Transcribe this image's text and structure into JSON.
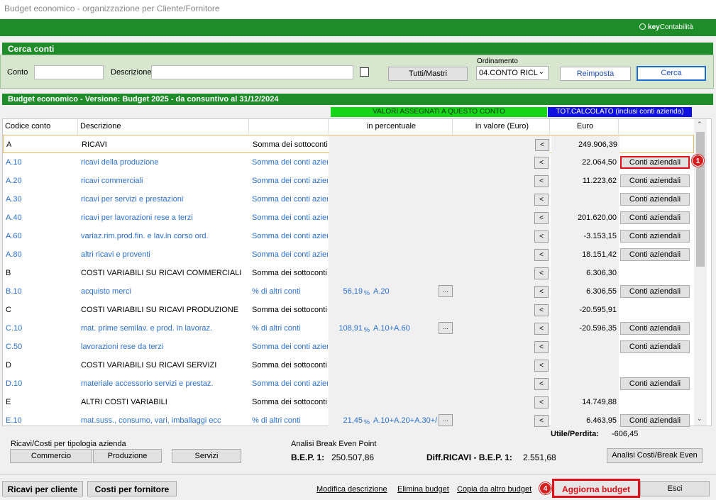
{
  "window": {
    "title": "Budget economico - organizzazione per Cliente/Fornitore"
  },
  "brand": {
    "key": "key",
    "name": "Contabilità"
  },
  "search": {
    "section_title": "Cerca conti",
    "conto_label": "Conto",
    "conto_value": "",
    "descrizione_label": "Descrizione",
    "descrizione_value": "",
    "tutti_label": "Tutti/Mastri",
    "ordinamento_label": "Ordinamento",
    "ordinamento_value": "04.CONTO RICL",
    "reimposta_label": "Reimposta",
    "cerca_label": "Cerca"
  },
  "budget": {
    "title": "Budget economico - Versione:   Budget 2025 - da consuntivo al 31/12/2024",
    "banner_assigned": "VALORI ASSEGNATI A QUESTO CONTO",
    "banner_total": "TOT.CALCOLATO (inclusi conti azienda)",
    "columns": [
      "Codice conto",
      "Descrizione",
      "",
      "in percentuale",
      "in valore (Euro)",
      "Euro"
    ],
    "row_button": "<",
    "aziendali_button": "Conti aziendali",
    "dots_button": "...",
    "pct_sign": "%",
    "rows": [
      {
        "code": "A",
        "desc": "RICAVI",
        "type": "Somma dei sottoconti",
        "pct": "",
        "ref": "",
        "euro": "249.906,39",
        "main": true,
        "dots": false,
        "btn": false
      },
      {
        "code": "A.10",
        "desc": "ricavi della produzione",
        "type": "Somma dei conti azien",
        "pct": "",
        "ref": "",
        "euro": "22.064,50",
        "main": false,
        "dots": false,
        "btn": true
      },
      {
        "code": "A.20",
        "desc": "ricavi commerciali",
        "type": "Somma dei conti azien",
        "pct": "",
        "ref": "",
        "euro": "11.223,62",
        "main": false,
        "dots": false,
        "btn": true
      },
      {
        "code": "A.30",
        "desc": "ricavi per servizi e prestazioni",
        "type": "Somma dei conti azien",
        "pct": "",
        "ref": "",
        "euro": "",
        "main": false,
        "dots": false,
        "btn": true
      },
      {
        "code": "A.40",
        "desc": "ricavi per lavorazioni rese a terzi",
        "type": "Somma dei conti azien",
        "pct": "",
        "ref": "",
        "euro": "201.620,00",
        "main": false,
        "dots": false,
        "btn": true
      },
      {
        "code": "A.60",
        "desc": "variaz.rim.prod.fin. e lav.in corso ord.",
        "type": "Somma dei conti azien",
        "pct": "",
        "ref": "",
        "euro": "-3.153,15",
        "main": false,
        "dots": false,
        "btn": true
      },
      {
        "code": "A.80",
        "desc": "altri ricavi e proventi",
        "type": "Somma dei conti azien",
        "pct": "",
        "ref": "",
        "euro": "18.151,42",
        "main": false,
        "dots": false,
        "btn": true
      },
      {
        "code": "B",
        "desc": "COSTI VARIABILI SU RICAVI COMMERCIALI",
        "type": "Somma dei sottoconti",
        "pct": "",
        "ref": "",
        "euro": "6.306,30",
        "main": true,
        "dots": false,
        "btn": false
      },
      {
        "code": "B.10",
        "desc": "acquisto merci",
        "type": "% di altri conti",
        "pct": "56,19",
        "ref": "A.20",
        "euro": "6.306,55",
        "main": false,
        "dots": true,
        "btn": true
      },
      {
        "code": "C",
        "desc": "COSTI VARIABILI SU RICAVI PRODUZIONE",
        "type": "Somma dei sottoconti",
        "pct": "",
        "ref": "",
        "euro": "-20.595,91",
        "main": true,
        "dots": false,
        "btn": false
      },
      {
        "code": "C.10",
        "desc": "mat. prime semilav. e prod. in lavoraz.",
        "type": "% di altri conti",
        "pct": "108,91",
        "ref": "A.10+A.60",
        "euro": "-20.596,35",
        "main": false,
        "dots": true,
        "btn": true
      },
      {
        "code": "C.50",
        "desc": "lavorazioni rese da terzi",
        "type": "Somma dei conti azien",
        "pct": "",
        "ref": "",
        "euro": "",
        "main": false,
        "dots": false,
        "btn": true
      },
      {
        "code": "D",
        "desc": "COSTI VARIABILI SU RICAVI SERVIZI",
        "type": "Somma dei sottoconti",
        "pct": "",
        "ref": "",
        "euro": "",
        "main": true,
        "dots": false,
        "btn": false
      },
      {
        "code": "D.10",
        "desc": "materiale accessorio servizi e prestaz.",
        "type": "Somma dei conti azien",
        "pct": "",
        "ref": "",
        "euro": "",
        "main": false,
        "dots": false,
        "btn": true
      },
      {
        "code": "E",
        "desc": "ALTRI COSTI VARIABILI",
        "type": "Somma dei sottoconti",
        "pct": "",
        "ref": "",
        "euro": "14.749,88",
        "main": true,
        "dots": false,
        "btn": false
      },
      {
        "code": "E.10",
        "desc": "mat.suss., consumo, vari, imballaggi ecc",
        "type": "% di altri conti",
        "pct": "21,45",
        "ref": "A.10+A.20+A.30+/",
        "euro": "6.463,95",
        "main": false,
        "dots": true,
        "btn": true
      }
    ]
  },
  "badges": {
    "one": "1",
    "four": "4"
  },
  "footer": {
    "utile_label": "Utile/Perdita:",
    "utile_value": "-606,45",
    "tipologia_label": "Ricavi/Costi per tipologia azienda",
    "commercio": "Commercio",
    "produzione": "Produzione",
    "servizi": "Servizi",
    "bep_title": "Analisi Break Even Point",
    "bep_label": "B.E.P. 1:",
    "bep_value": "250.507,86",
    "diff_label": "Diff.RICAVI - B.E.P. 1:",
    "diff_value": "2.551,68",
    "analisi_button": "Analisi Costi/Break Even"
  },
  "bottom": {
    "ricavi_cliente": "Ricavi per cliente",
    "costi_fornitore": "Costi per fornitore",
    "modifica": "Modifica descrizione",
    "elimina": "Elimina budget",
    "copia": "Copia da altro budget",
    "aggiorna": "Aggiorna budget",
    "esci": "Esci"
  }
}
